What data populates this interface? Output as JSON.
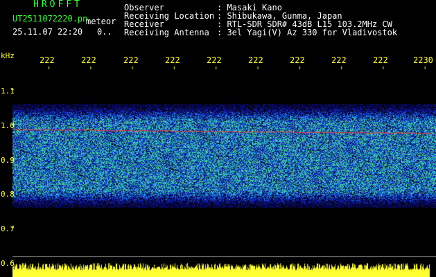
{
  "header": {
    "logo": "HROFFT",
    "filename": "UT2511072220.pn",
    "mode": "meteor",
    "datetime": "25.11.07 22:20",
    "count": "0..",
    "fields": [
      {
        "label": "Observer",
        "value": ": Masaki Kano"
      },
      {
        "label": "Receiving Location",
        "value": ": Shibukawa, Gunma, Japan"
      },
      {
        "label": "Receiver",
        "value": ": RTL-SDR SDR# 43dB L15 103.2MHz CW"
      },
      {
        "label": "Receiving Antenna",
        "value": ": 3el Yagi(V) Az 330 for Vladivostok"
      }
    ]
  },
  "axis": {
    "unit": "kHz",
    "time_ticks": [
      "222",
      "222",
      "222",
      "222",
      "222",
      "222",
      "222",
      "222",
      "222",
      "2230"
    ],
    "freq_ticks": [
      "1.1",
      "1.0",
      "0.9",
      "0.8",
      "0.7",
      "0.6"
    ]
  },
  "colors": {
    "text_header": "#ffffff",
    "logo": "#33ff33",
    "axis": "#ffff33",
    "signal_line": "#ff3333"
  }
}
